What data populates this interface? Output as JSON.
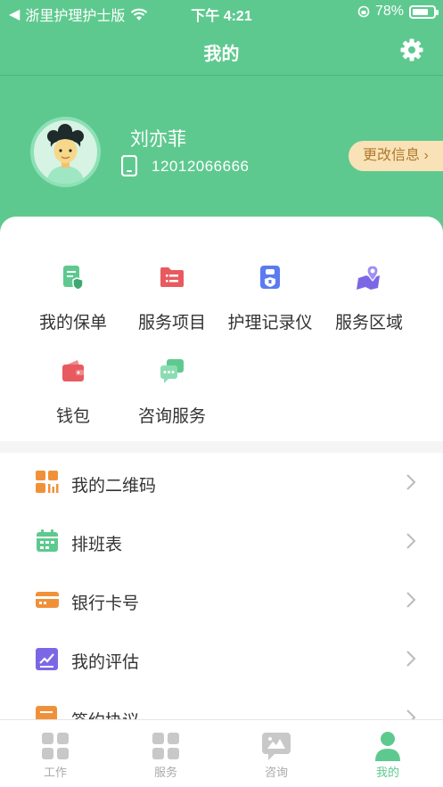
{
  "status_bar": {
    "carrier": "浙里护理护士版",
    "time": "下午 4:21",
    "battery": "78%",
    "battery_level": 0.78
  },
  "navbar": {
    "title": "我的",
    "settings_icon": "gear-icon"
  },
  "profile": {
    "name": "刘亦菲",
    "phone": "12012066666",
    "edit_label": "更改信息"
  },
  "grid": {
    "items": [
      {
        "label": "我的保单",
        "icon": "policy-icon",
        "color": "#5ec98f"
      },
      {
        "label": "服务项目",
        "icon": "folder-icon",
        "color": "#e85a5f"
      },
      {
        "label": "护理记录仪",
        "icon": "recorder-icon",
        "color": "#5b7bf0"
      },
      {
        "label": "服务区域",
        "icon": "map-pin-icon",
        "color": "#7b67e6"
      },
      {
        "label": "钱包",
        "icon": "wallet-icon",
        "color": "#e85a5f"
      },
      {
        "label": "咨询服务",
        "icon": "chat-icon",
        "color": "#5ec98f"
      }
    ]
  },
  "menu": {
    "items": [
      {
        "label": "我的二维码",
        "icon": "qrcode-icon",
        "color": "#f0913a"
      },
      {
        "label": "排班表",
        "icon": "calendar-icon",
        "color": "#5ec98f"
      },
      {
        "label": "银行卡号",
        "icon": "bank-card-icon",
        "color": "#f0913a"
      },
      {
        "label": "我的评估",
        "icon": "assessment-icon",
        "color": "#7b67e6"
      },
      {
        "label": "签约协议",
        "icon": "contract-icon",
        "color": "#f0913a"
      }
    ]
  },
  "tabbar": {
    "tabs": [
      {
        "label": "工作",
        "icon": "grid-icon",
        "active": false
      },
      {
        "label": "服务",
        "icon": "grid-icon",
        "active": false
      },
      {
        "label": "咨询",
        "icon": "chat-bubble-icon",
        "active": false
      },
      {
        "label": "我的",
        "icon": "person-icon",
        "active": true
      }
    ],
    "active_color": "#5ec98f",
    "inactive_color": "#c8c8c8"
  }
}
